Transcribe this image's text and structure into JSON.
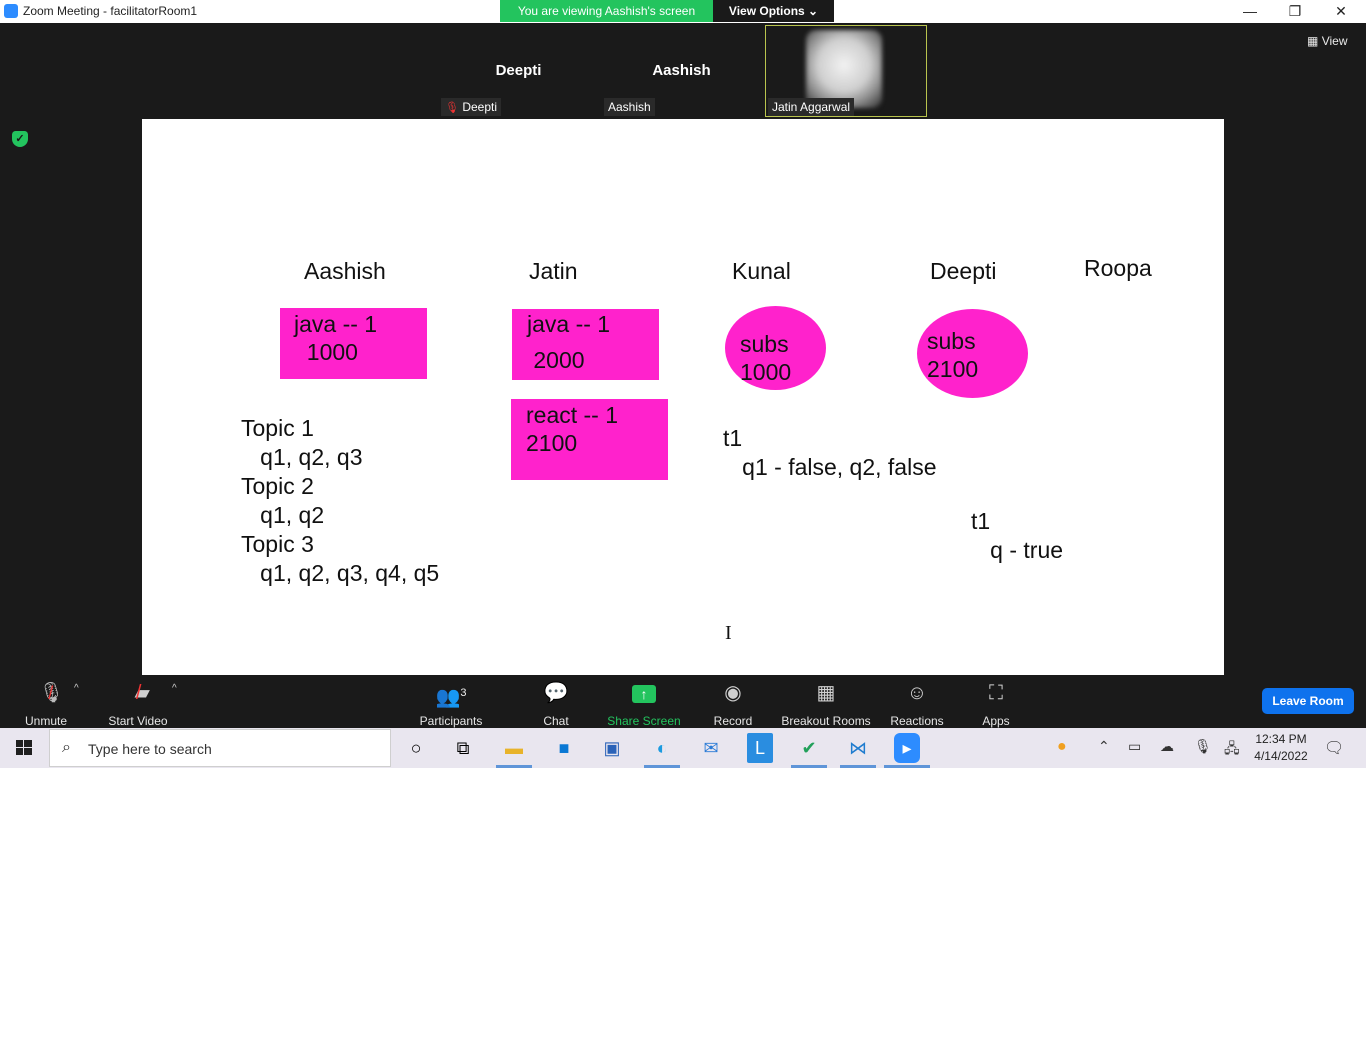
{
  "window": {
    "title": "Zoom Meeting - facilitatorRoom1",
    "minimize_glyph": "—",
    "restore_glyph": "❐",
    "close_glyph": "✕"
  },
  "banner": {
    "viewing_text": "You are viewing Aashish's screen",
    "view_options_label": "View Options ⌄"
  },
  "thumbnails": [
    {
      "name": "Deepti",
      "label": "Deepti",
      "muted": true
    },
    {
      "name": "Aashish",
      "label": "Aashish",
      "muted": false
    },
    {
      "name": "",
      "label": "Jatin Aggarwal",
      "muted": false,
      "active_speaker": true
    }
  ],
  "view_button": {
    "icon": "grid-icon",
    "label": "View"
  },
  "whiteboard": {
    "names": [
      "Aashish",
      "Jatin",
      "Kunal",
      "Deepti",
      "Roopa"
    ],
    "notes": {
      "aashish_java": "java -- 1\n  1000",
      "jatin_java": "java -- 1\n 2000",
      "jatin_react": "react -- 1\n2100",
      "kunal_subs": "subs\n1000",
      "deepti_subs": "subs\n2100"
    },
    "topics": "Topic 1\n   q1, q2, q3\nTopic 2\n   q1, q2\nTopic 3\n   q1, q2, q3, q4, q5",
    "kunal_t1": "t1\n   q1 - false, q2, false",
    "deepti_t1": "t1\n   q - true",
    "cursor": "I",
    "note_color": "#ff22cc"
  },
  "toolbar": {
    "unmute": "Unmute",
    "start_video": "Start Video",
    "participants": "Participants",
    "participant_count": "3",
    "chat": "Chat",
    "share_screen": "Share Screen",
    "record": "Record",
    "breakout_rooms": "Breakout Rooms",
    "reactions": "Reactions",
    "apps": "Apps",
    "leave_room": "Leave Room"
  },
  "taskbar": {
    "search_placeholder": "Type here to search",
    "time": "12:34 PM",
    "date": "4/14/2022"
  },
  "colors": {
    "accent_green": "#23c45e",
    "leave_blue": "#0e72ed",
    "app_dark": "#1a1a1a"
  }
}
